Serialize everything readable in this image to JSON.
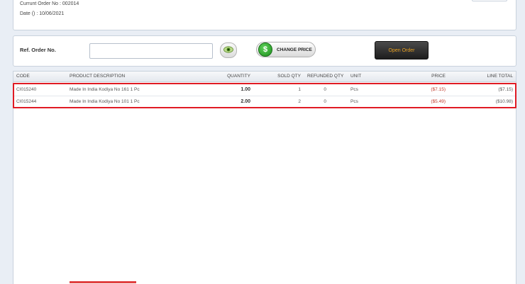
{
  "order": {
    "current_order_label": "Currunt Order No : 002014",
    "date_label": "Date () : 10/06/2021"
  },
  "ref": {
    "label": "Ref. Order No.",
    "value": "",
    "placeholder": ""
  },
  "buttons": {
    "change_price_label": "CHANGE PRICE",
    "dollar_glyph": "$",
    "open_order_label": "Open Order"
  },
  "icons": {
    "view": "eye-icon",
    "change_price": "dollar-icon"
  },
  "colors": {
    "price_negative": "#c0392b",
    "selection_border": "#e01b24",
    "open_order_text": "#e8a020",
    "dollar_green": "#1c8c1c"
  },
  "grid": {
    "columns": [
      "CODE",
      "PRODUCT DESCRIPTION",
      "QUANTITY",
      "SOLD QTY",
      "REFUNDED QTY",
      "UNIT",
      "PRICE",
      "LINE TOTAL"
    ],
    "rows": [
      {
        "code": "CI015240",
        "description": "Made In India Kodiya No 161 1 Pc",
        "quantity": "1.00",
        "sold_qty": "1",
        "refunded_qty": "0",
        "unit": "Pcs",
        "price": "($7.15)",
        "line_total": "($7.15)"
      },
      {
        "code": "CI015244",
        "description": "Made In India Kodiya No 101 1 Pc",
        "quantity": "2.00",
        "sold_qty": "2",
        "refunded_qty": "0",
        "unit": "Pcs",
        "price": "($5.49)",
        "line_total": "($10.98)"
      }
    ]
  }
}
